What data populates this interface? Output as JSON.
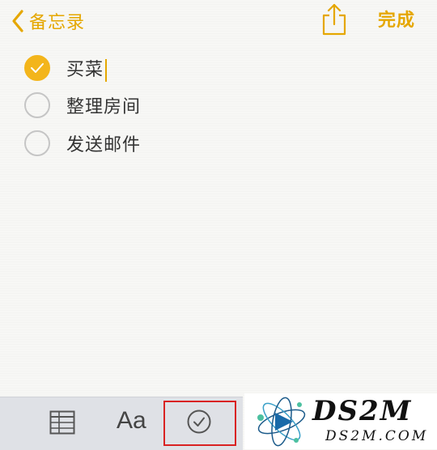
{
  "nav": {
    "back_label": "备忘录",
    "done_label": "完成",
    "accent_color": "#e5a700"
  },
  "checklist": {
    "items": [
      {
        "label": "买菜",
        "checked": true
      },
      {
        "label": "整理房间",
        "checked": false
      },
      {
        "label": "发送邮件",
        "checked": false
      }
    ],
    "checked_color": "#f3b51b"
  },
  "toolbar": {
    "format_label": "Aa",
    "icons": [
      "table-icon",
      "text-format",
      "checklist-icon"
    ],
    "highlight_color": "#d92222"
  },
  "watermark": {
    "title": "DS2M",
    "domain": "DS2M.COM"
  }
}
